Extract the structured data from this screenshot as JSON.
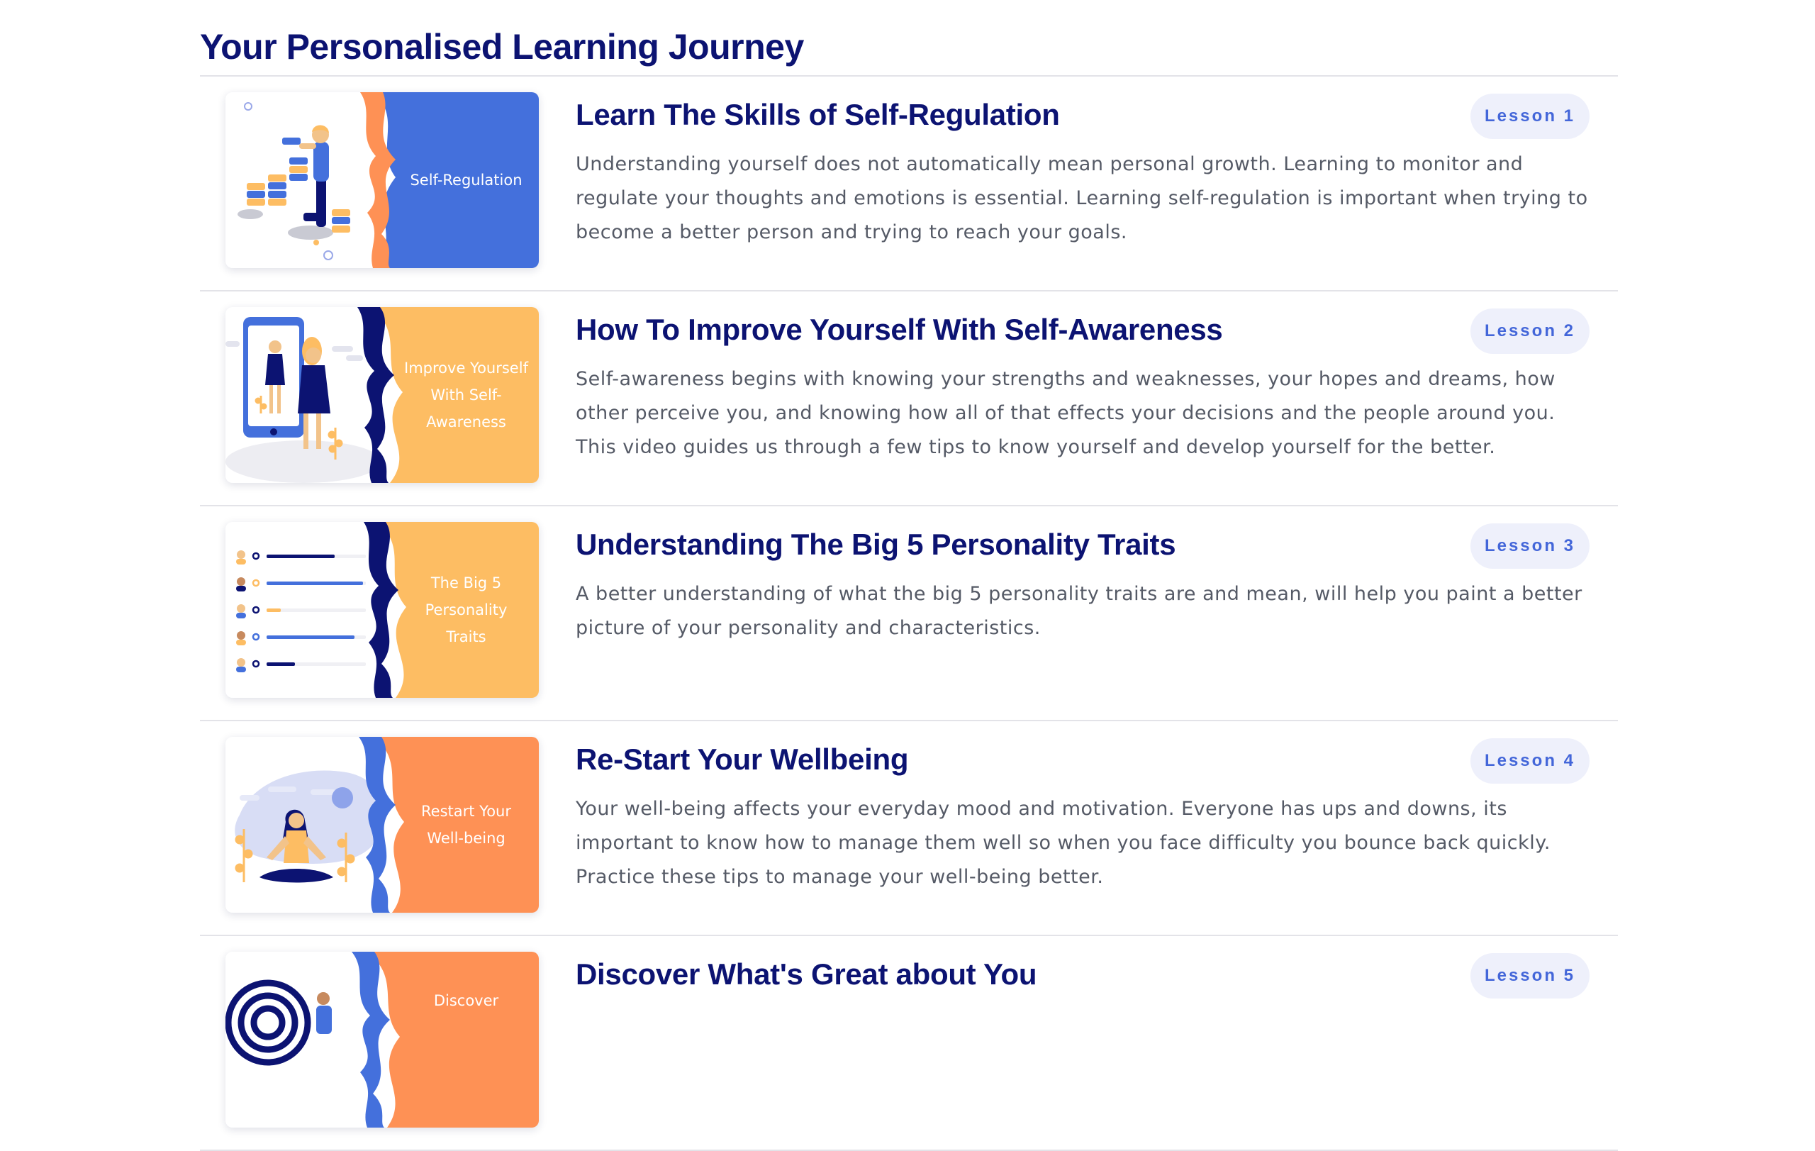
{
  "page": {
    "title": "Your Personalised Learning Journey"
  },
  "colors": {
    "navy": "#0c1372",
    "blue": "#4470dc",
    "yellow": "#fdbd63",
    "orange": "#fe9155",
    "badge_bg": "#eef0fb",
    "badge_text": "#4366d9",
    "body_text": "#555a66"
  },
  "lessons": [
    {
      "title": "Learn The Skills of Self-Regulation",
      "badge": "Lesson 1",
      "description": "Understanding yourself does not automatically mean personal growth. Learning to monitor and regulate your thoughts and emotions is essential. Learning self-regulation is important when trying to become a better person and trying to reach your goals.",
      "thumbnail_text": "Self-Regulation",
      "thumbnail_icon": "person-stacking-blocks-illustration"
    },
    {
      "title": "How To Improve Yourself With Self-Awareness",
      "badge": "Lesson 2",
      "description": "Self-awareness begins with knowing your strengths and weaknesses, your hopes and dreams, how other perceive you, and knowing how all of that effects your decisions and the people around you. This video guides us through a few tips to know yourself and develop yourself for the better.",
      "thumbnail_text": "Improve Yourself With Self-Awareness",
      "thumbnail_icon": "woman-with-phone-reflection-illustration"
    },
    {
      "title": "Understanding The Big 5 Personality Traits",
      "badge": "Lesson 3",
      "description": "A better understanding of what the big 5 personality traits are and mean, will help you paint a better picture of your personality and characteristics.",
      "thumbnail_text": "The Big 5 Personality Traits",
      "thumbnail_icon": "personality-bars-illustration"
    },
    {
      "title": "Re-Start Your Wellbeing",
      "badge": "Lesson 4",
      "description": "Your well-being affects your everyday mood and motivation. Everyone has ups and downs, its important to know how to manage them well so when you face difficulty you bounce back quickly. Practice these tips to manage your well-being better.",
      "thumbnail_text": "Restart Your Well-being",
      "thumbnail_icon": "meditating-woman-illustration"
    },
    {
      "title": "Discover What's Great about You",
      "badge": "Lesson 5",
      "description": "",
      "thumbnail_text": "Discover",
      "thumbnail_icon": "target-person-illustration"
    }
  ]
}
